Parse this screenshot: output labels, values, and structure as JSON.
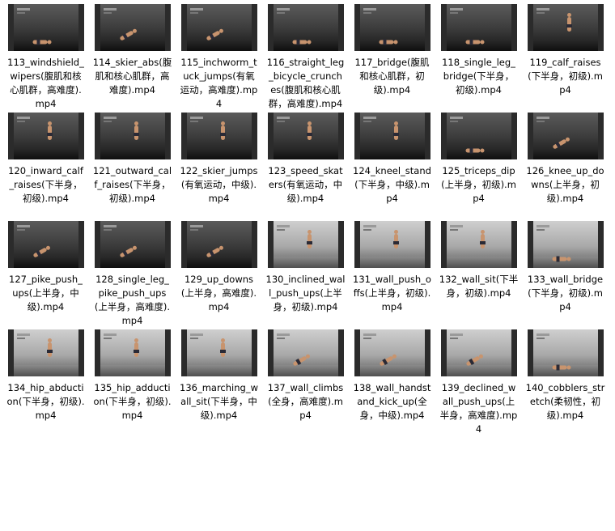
{
  "files": [
    {
      "name": "113_windshield_wipers(腹肌和核心肌群，高难度).mp4",
      "pose": "floor",
      "theme": "dark"
    },
    {
      "name": "114_skier_abs(腹肌和核心肌群，高难度).mp4",
      "pose": "plank",
      "theme": "dark"
    },
    {
      "name": "115_inchworm_tuck_jumps(有氧运动，高难度).mp4",
      "pose": "plank",
      "theme": "dark"
    },
    {
      "name": "116_straight_leg_bicycle_crunches(腹肌和核心肌群，高难度).mp4",
      "pose": "floor",
      "theme": "dark"
    },
    {
      "name": "117_bridge(腹肌和核心肌群，初级).mp4",
      "pose": "floor",
      "theme": "dark"
    },
    {
      "name": "118_single_leg_bridge(下半身，初级).mp4",
      "pose": "floor",
      "theme": "dark"
    },
    {
      "name": "119_calf_raises(下半身，初级).mp4",
      "pose": "stand",
      "theme": "dark"
    },
    {
      "name": "120_inward_calf_raises(下半身，初级).mp4",
      "pose": "stand",
      "theme": "dark"
    },
    {
      "name": "121_outward_calf_raises(下半身，初级).mp4",
      "pose": "stand",
      "theme": "dark"
    },
    {
      "name": "122_skier_jumps(有氧运动，中级).mp4",
      "pose": "stand",
      "theme": "dark"
    },
    {
      "name": "123_speed_skaters(有氧运动，中级).mp4",
      "pose": "stand",
      "theme": "dark"
    },
    {
      "name": "124_kneel_stand(下半身，中级).mp4",
      "pose": "stand",
      "theme": "dark"
    },
    {
      "name": "125_triceps_dip(上半身，初级).mp4",
      "pose": "floor",
      "theme": "dark"
    },
    {
      "name": "126_knee_up_downs(上半身，初级).mp4",
      "pose": "plank",
      "theme": "dark"
    },
    {
      "name": "127_pike_push_ups(上半身，中级).mp4",
      "pose": "plank",
      "theme": "dark"
    },
    {
      "name": "128_single_leg_pike_push_ups(上半身，高难度).mp4",
      "pose": "plank",
      "theme": "dark"
    },
    {
      "name": "129_up_downs(上半身，高难度).mp4",
      "pose": "plank",
      "theme": "dark"
    },
    {
      "name": "130_inclined_wall_push_ups(上半身，初级).mp4",
      "pose": "stand",
      "theme": "light"
    },
    {
      "name": "131_wall_push_offs(上半身，初级).mp4",
      "pose": "stand",
      "theme": "light"
    },
    {
      "name": "132_wall_sit(下半身，初级).mp4",
      "pose": "stand",
      "theme": "light"
    },
    {
      "name": "133_wall_bridge(下半身，初级).mp4",
      "pose": "floor",
      "theme": "light"
    },
    {
      "name": "134_hip_abduction(下半身，初级).mp4",
      "pose": "stand",
      "theme": "light"
    },
    {
      "name": "135_hip_adduction(下半身，初级).mp4",
      "pose": "stand",
      "theme": "light"
    },
    {
      "name": "136_marching_wall_sit(下半身，中级).mp4",
      "pose": "stand",
      "theme": "light"
    },
    {
      "name": "137_wall_climbs(全身，高难度).mp4",
      "pose": "plank",
      "theme": "light"
    },
    {
      "name": "138_wall_handstand_kick_up(全身，中级).mp4",
      "pose": "plank",
      "theme": "light"
    },
    {
      "name": "139_declined_wall_push_ups(上半身，高难度).mp4",
      "pose": "plank",
      "theme": "light"
    },
    {
      "name": "140_cobblers_stretch(柔韧性，初级).mp4",
      "pose": "floor",
      "theme": "light"
    }
  ],
  "icon": "video-thumbnail-icon"
}
